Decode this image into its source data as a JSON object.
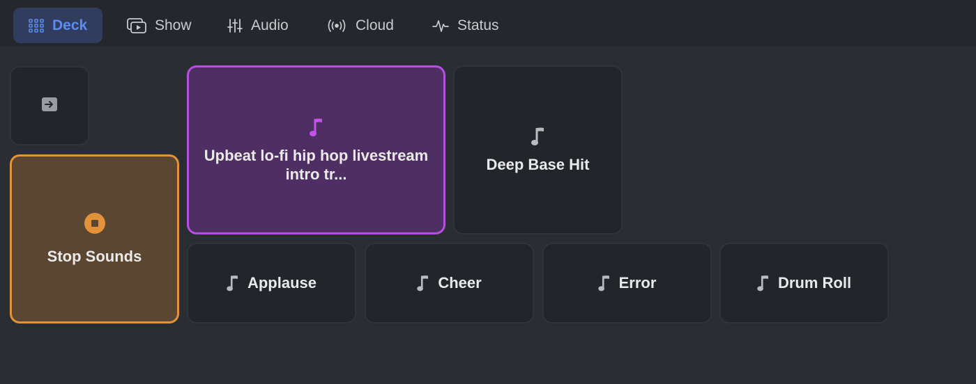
{
  "nav": {
    "tabs": [
      {
        "label": "Deck",
        "icon": "grid-icon",
        "active": true
      },
      {
        "label": "Show",
        "icon": "screen-play-icon",
        "active": false
      },
      {
        "label": "Audio",
        "icon": "sliders-icon",
        "active": false
      },
      {
        "label": "Cloud",
        "icon": "broadcast-icon",
        "active": false
      },
      {
        "label": "Status",
        "icon": "pulse-icon",
        "active": false
      }
    ]
  },
  "deck": {
    "exit_button": {
      "icon": "arrow-right-square-icon"
    },
    "stop_button": {
      "label": "Stop Sounds",
      "icon": "stop-circle-icon",
      "color": "#e4923a"
    },
    "sounds": [
      {
        "label": "Upbeat lo-fi hip hop livestream intro tr...",
        "icon": "music-note-icon",
        "playing": true,
        "color": "#b44fe0"
      },
      {
        "label": "Deep Base Hit",
        "icon": "music-note-icon"
      },
      {
        "label": "Applause",
        "icon": "music-note-icon"
      },
      {
        "label": "Cheer",
        "icon": "music-note-icon"
      },
      {
        "label": "Error",
        "icon": "music-note-icon"
      },
      {
        "label": "Drum Roll",
        "icon": "music-note-icon"
      }
    ]
  },
  "colors": {
    "accent_blue": "#5b8cf2",
    "active_tab_bg": "#303d5e",
    "playing_purple": "#b44fe0",
    "stop_orange": "#e4923a"
  }
}
